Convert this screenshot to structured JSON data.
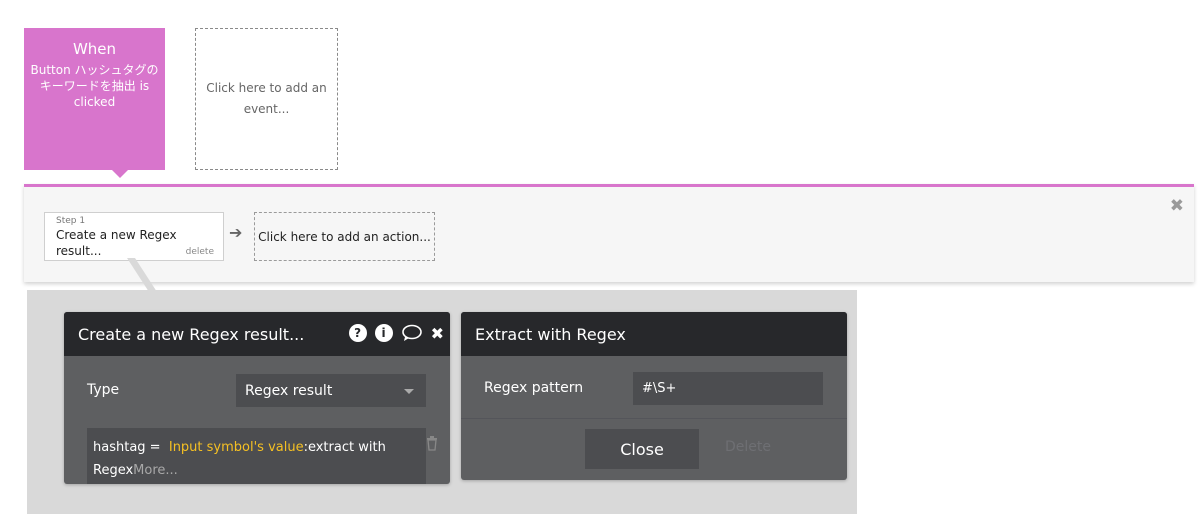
{
  "events": {
    "when_title": "When",
    "when_desc": "Button ハッシュタグの\nキーワードを抽出 is\nclicked",
    "add_event": "Click here to add an event..."
  },
  "workflow": {
    "close_glyph": "✖",
    "step_label": "Step 1",
    "step_name": "Create a new Regex result...",
    "step_delete": "delete",
    "arrow_glyph": "➔",
    "add_action": "Click here to add an action..."
  },
  "left_panel": {
    "title": "Create a new Regex result...",
    "icons": [
      "help-icon",
      "info-icon",
      "comment-icon",
      "close-icon"
    ],
    "type_label": "Type",
    "type_value": "Regex result",
    "field_name": "hashtag",
    "field_eq": " = ",
    "field_highlight": "Input symbol's value",
    "field_rest": ":extract with Regex",
    "field_more": "More..."
  },
  "right_panel": {
    "title": "Extract with Regex",
    "pattern_label": "Regex pattern",
    "pattern_value": "#\\S+",
    "close_label": "Close",
    "delete_label": "Delete"
  },
  "colors": {
    "accent": "#d875cc",
    "panel_header": "#27282b",
    "panel_body": "#5e5f61",
    "highlight": "#f5c023"
  }
}
